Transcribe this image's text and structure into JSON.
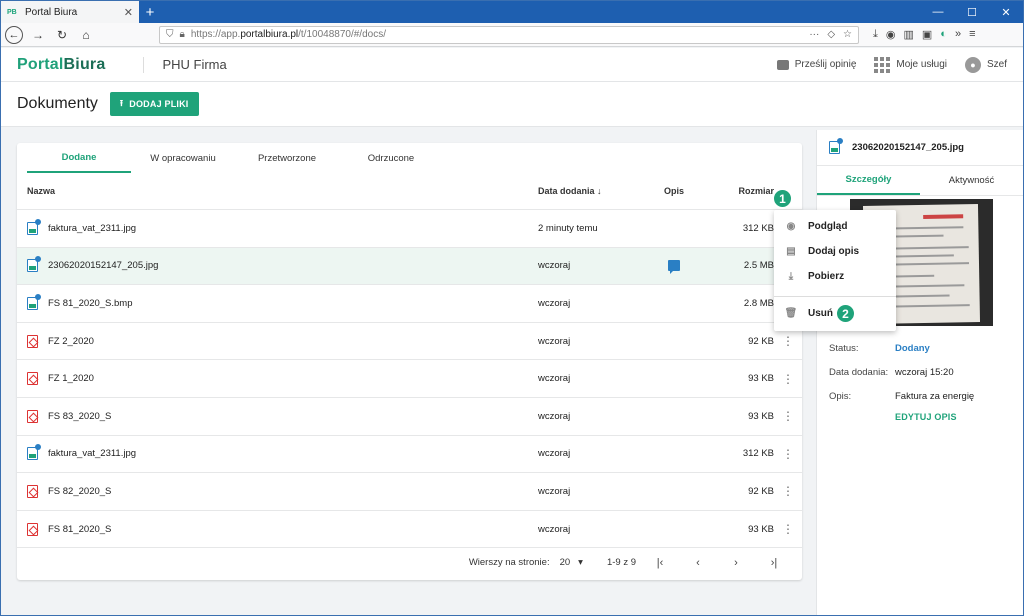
{
  "browser": {
    "tab_title": "Portal Biura",
    "tab_favicon": "PB",
    "url_prefix": "https://app.",
    "url_domain": "portalbiura.pl",
    "url_path": "/t/10048870/#/docs/"
  },
  "topbar": {
    "logo_part1": "Portal",
    "logo_part2": "Biura",
    "company": "PHU Firma",
    "feedback_label": "Prześlij opinię",
    "services_label": "Moje usługi",
    "user_label": "Szef"
  },
  "page": {
    "title": "Dokumenty",
    "add_button": "DODAJ PLIKI"
  },
  "tabs": [
    "Dodane",
    "W opracowaniu",
    "Przetworzone",
    "Odrzucone"
  ],
  "table": {
    "headers": {
      "name": "Nazwa",
      "date": "Data dodania",
      "desc": "Opis",
      "size": "Rozmiar"
    },
    "rows": [
      {
        "name": "faktura_vat_2311.jpg",
        "date": "2 minuty temu",
        "size": "312 KB",
        "type": "img",
        "comment": false
      },
      {
        "name": "23062020152147_205.jpg",
        "date": "wczoraj",
        "size": "2.5 MB",
        "type": "img",
        "comment": true
      },
      {
        "name": "FS 81_2020_S.bmp",
        "date": "wczoraj",
        "size": "2.8 MB",
        "type": "img",
        "comment": false
      },
      {
        "name": "FZ 2_2020",
        "date": "wczoraj",
        "size": "92 KB",
        "type": "pdf",
        "comment": false
      },
      {
        "name": "FZ 1_2020",
        "date": "wczoraj",
        "size": "93 KB",
        "type": "pdf",
        "comment": false
      },
      {
        "name": "FS 83_2020_S",
        "date": "wczoraj",
        "size": "93 KB",
        "type": "pdf",
        "comment": false
      },
      {
        "name": "faktura_vat_2311.jpg",
        "date": "wczoraj",
        "size": "312 KB",
        "type": "img",
        "comment": false
      },
      {
        "name": "FS 82_2020_S",
        "date": "wczoraj",
        "size": "92 KB",
        "type": "pdf",
        "comment": false
      },
      {
        "name": "FS 81_2020_S",
        "date": "wczoraj",
        "size": "93 KB",
        "type": "pdf",
        "comment": false
      }
    ]
  },
  "pager": {
    "rows_label": "Wierszy na stronie:",
    "rows_value": "20",
    "range": "1-9 z 9"
  },
  "context_menu": {
    "preview": "Podgląd",
    "add_desc": "Dodaj opis",
    "download": "Pobierz",
    "delete": "Usuń"
  },
  "badges": {
    "one": "1",
    "two": "2"
  },
  "side": {
    "filename": "23062020152147_205.jpg",
    "tab_details": "Szczegóły",
    "tab_activity": "Aktywność",
    "status_label": "Status:",
    "status_value": "Dodany",
    "date_label": "Data dodania:",
    "date_value": "wczoraj 15:20",
    "desc_label": "Opis:",
    "desc_value": "Faktura za energię",
    "edit_label": "EDYTUJ OPIS"
  },
  "colors": {
    "accent": "#1fa37a",
    "link": "#2a7fc4",
    "pdf": "#dd3333"
  }
}
